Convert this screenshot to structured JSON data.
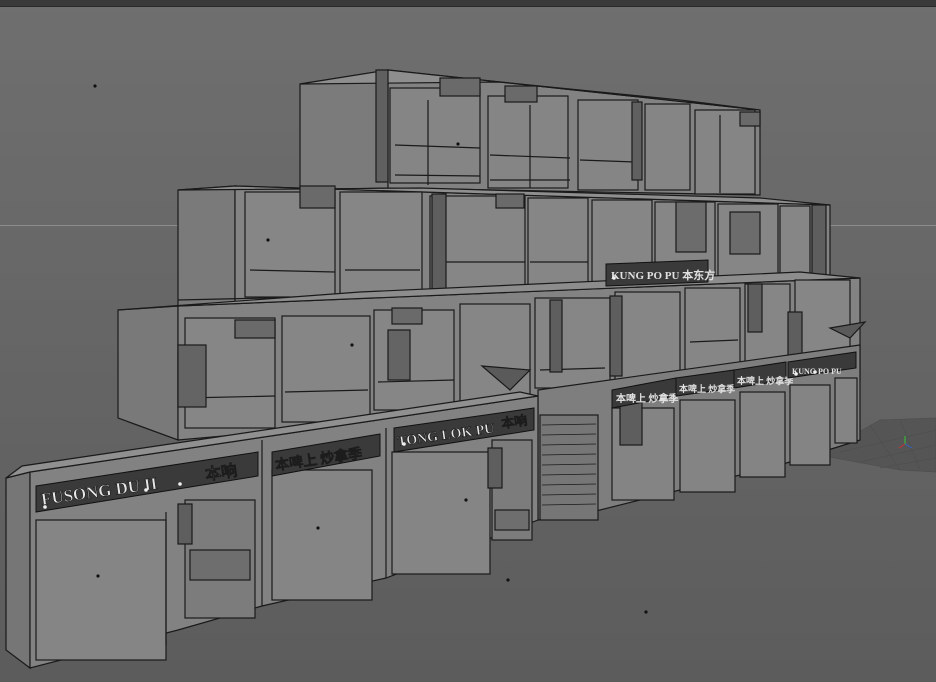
{
  "viewport": {
    "title_bar_text": "",
    "background_color": "#666666",
    "model_color": "#7a7a7a",
    "wire_color": "#1a1a1a"
  },
  "signs": {
    "fusong": "FUSONG DU II",
    "fusong_cn": "本响",
    "middle_cn": "本啤上 炒拿季",
    "tong_lok": "TONG LOK PU",
    "tong_lok_cn": "本响",
    "upper_cn": "KUNG PO PU 本东方",
    "right_1": "本啤上 炒拿季",
    "right_2": "本啤上 炒拿季",
    "right_3": "本啤上 炒拿季",
    "right_4": "KUNG PO PU"
  },
  "gizmo": {
    "axis_colors": [
      "#c83232",
      "#32c832",
      "#3264c8"
    ],
    "icon": "axis-gizmo-icon"
  }
}
